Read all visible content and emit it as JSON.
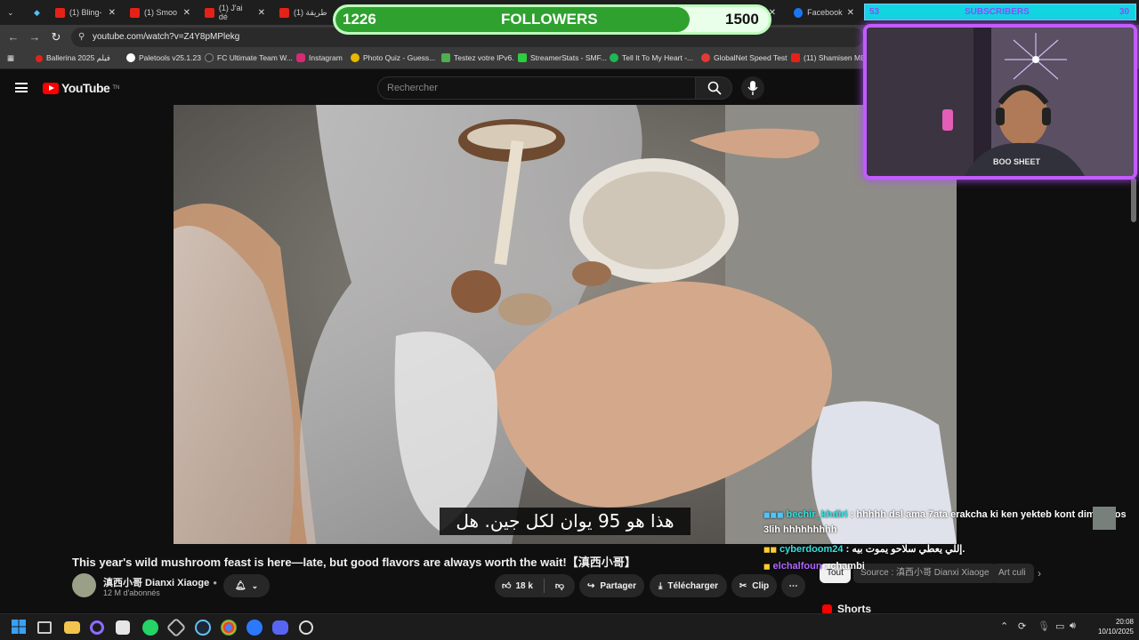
{
  "browser": {
    "tabs": [
      {
        "label": "(1) Bling-"
      },
      {
        "label": "(1) Smoo"
      },
      {
        "label": "(1) J'ai dé"
      },
      {
        "label": "(1) طريقة"
      },
      {
        "label": "Facebook"
      }
    ],
    "url": "youtube.com/watch?v=Z4Y8pMPlekg",
    "bookmarks": [
      {
        "label": "Ballerina 2025 فيلم",
        "color": "#e62117"
      },
      {
        "label": "Paletools v25.1.23",
        "color": "#ffffff"
      },
      {
        "label": "FC Ultimate Team W...",
        "color": "#333333"
      },
      {
        "label": "Instagram",
        "color": "#d62976"
      },
      {
        "label": "Photo Quiz - Guess...",
        "color": "#e8b700"
      },
      {
        "label": "Testez votre IPv6.",
        "color": "#4caf50"
      },
      {
        "label": "StreamerStats - SMF...",
        "color": "#2ecc40"
      },
      {
        "label": "Tell It To My Heart -...",
        "color": "#1db954"
      },
      {
        "label": "GlobalNet Speed Test",
        "color": "#e53935"
      },
      {
        "label": "(11) Shamisen ME",
        "color": "#e62117"
      }
    ]
  },
  "youtube": {
    "logo_text": "YouTube",
    "logo_sup": "TN",
    "search_placeholder": "Rechercher",
    "subtitle": "هذا هو 95 يوان لكل جين. هل",
    "title": "This year's wild mushroom feast is here—late, but good flavors are always worth the wait!【滇西小哥】",
    "channel": {
      "name": "滇西小哥 Dianxi Xiaoge",
      "subscribers": "12 M d'abonnés"
    },
    "actions": {
      "likes": "18 k",
      "share": "Partager",
      "download": "Télécharger",
      "clip": "Clip"
    },
    "chips": [
      "Tout",
      "Source : 滇西小哥 Dianxi Xiaoge",
      "Art culi"
    ],
    "shorts": "Shorts"
  },
  "overlay": {
    "followers": {
      "current": "1226",
      "label": "FOLLOWERS",
      "goal": "1500",
      "progress": 0.817
    },
    "subscribers": {
      "current": "53",
      "label": "SUBSCRIBERS",
      "goal": "30",
      "progress": 1.0
    },
    "webcam_shirt": "BOO SHEET"
  },
  "chat": [
    {
      "user": "bechir_khdiri",
      "user_color": "#33e0e0",
      "message": ": hhhhh dsl ama 7ata erakcha ki ken yekteb kont dima n9os",
      "message2": "3lih hhhhhhhhh"
    },
    {
      "user": "cyberdoom24",
      "user_color": "#33e0e0",
      "message": ": إللي يعطي سلاحو يموت بيه."
    },
    {
      "user": "elchalfoun",
      "user_color": "#b066ff",
      "message": ": chambi"
    }
  ],
  "taskbar": {
    "time": "20:08",
    "date": "10/10/2025"
  },
  "colors": {
    "yt_red": "#ff0000",
    "followers_fill": "#2ea12e",
    "webcam_border": "#c25cff",
    "subs_bar": "#0ee5e5"
  }
}
